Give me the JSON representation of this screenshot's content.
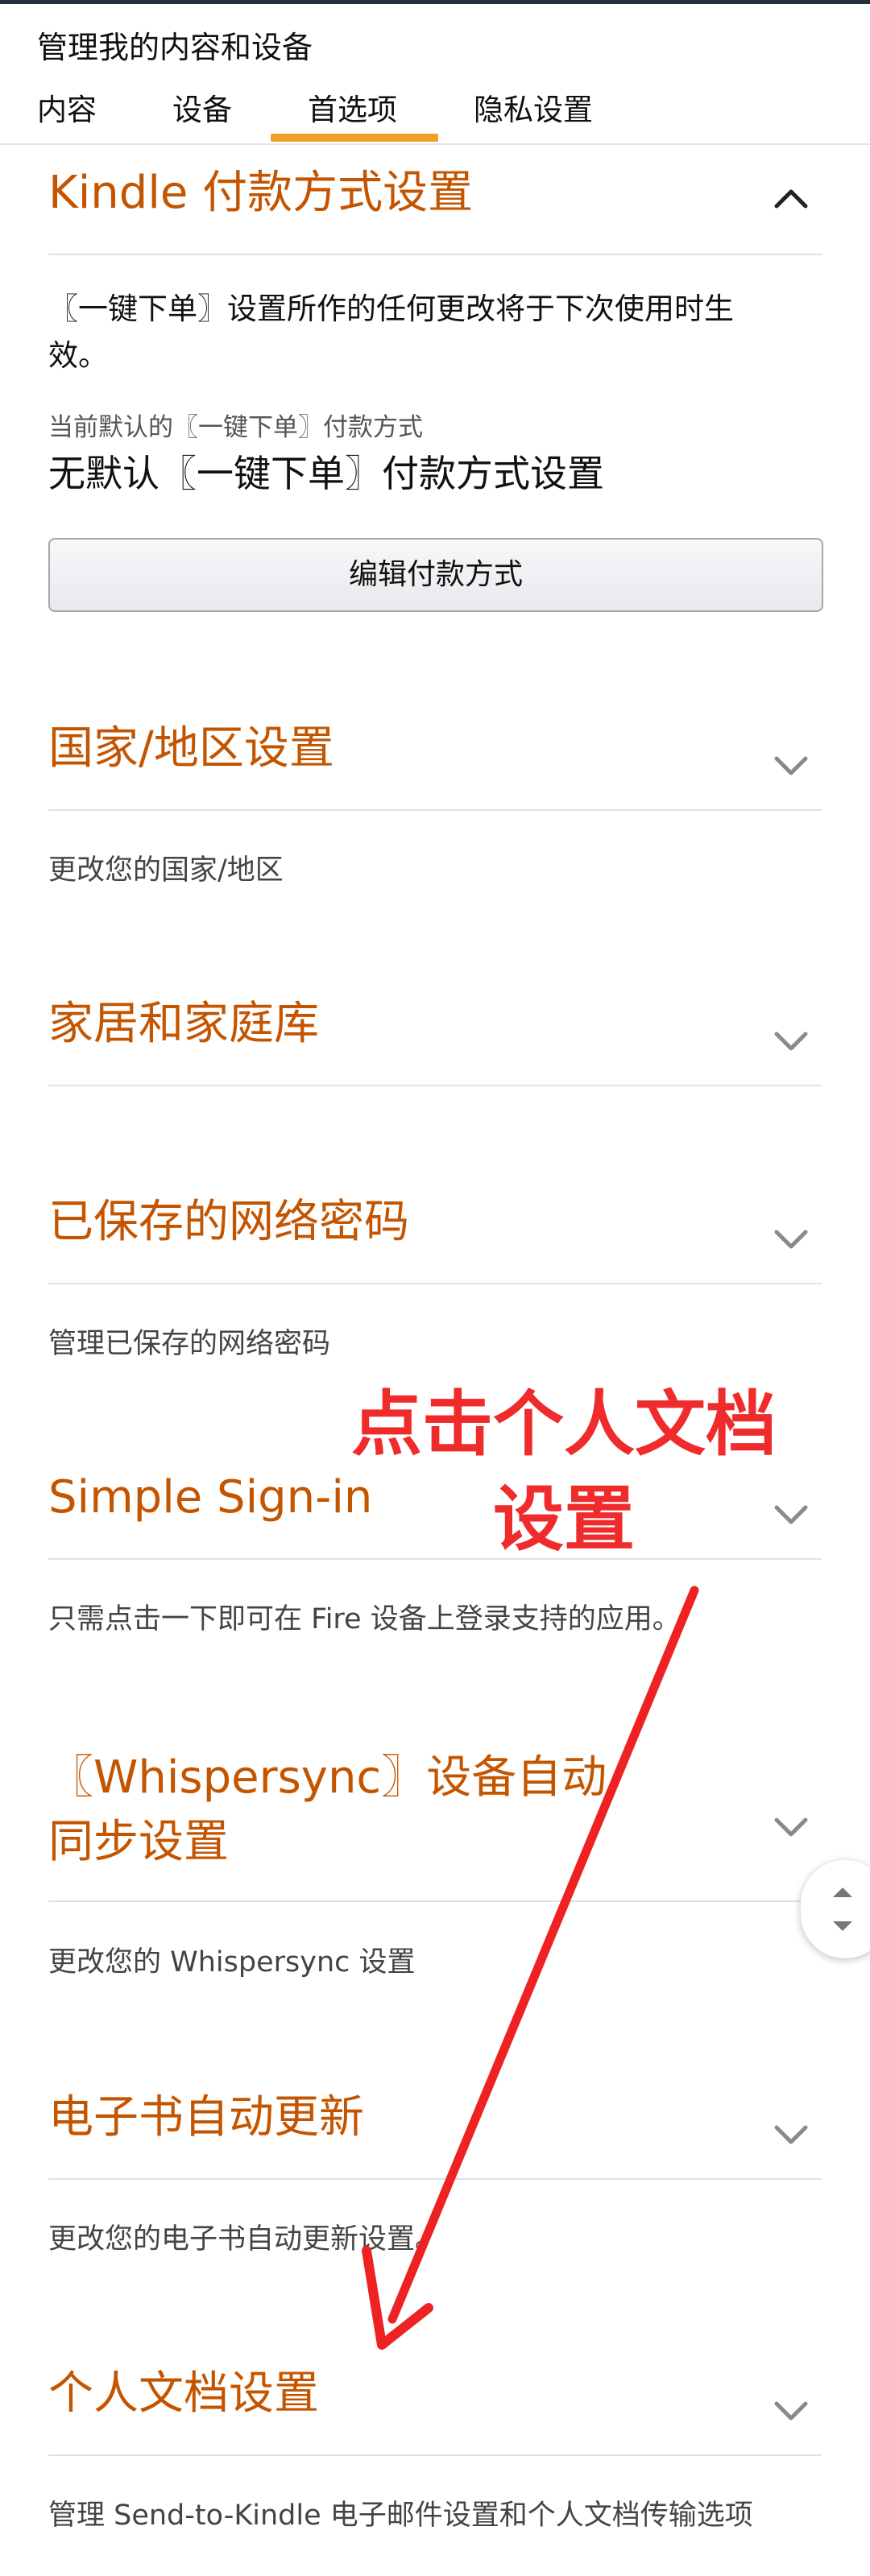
{
  "header": {
    "title": "管理我的内容和设备"
  },
  "tabs": [
    {
      "label": "内容"
    },
    {
      "label": "设备"
    },
    {
      "label": "首选项"
    },
    {
      "label": "隐私设置"
    }
  ],
  "sections": {
    "payment": {
      "title": "Kindle 付款方式设置",
      "note_line1": "〖一键下单〗设置所作的任何更改将于下次使用时生",
      "note_line2": "效。",
      "current_label": "当前默认的〖一键下单〗付款方式",
      "current_value": "无默认〖一键下单〗付款方式设置",
      "edit_button": "编辑付款方式"
    },
    "country": {
      "title": "国家/地区设置",
      "desc": "更改您的国家/地区"
    },
    "household": {
      "title": "家居和家庭库"
    },
    "wifi": {
      "title": "已保存的网络密码",
      "desc": "管理已保存的网络密码"
    },
    "signin": {
      "title": "Simple Sign-in",
      "desc": "只需点击一下即可在 Fire 设备上登录支持的应用。"
    },
    "whispersync": {
      "title_line1": "〖Whispersync〗设备自动",
      "title_line2": "同步设置",
      "desc": "更改您的 Whispersync 设置"
    },
    "ebook": {
      "title": "电子书自动更新",
      "desc": "更改您的电子书自动更新设置。"
    },
    "personal": {
      "title": "个人文档设置",
      "desc": "管理 Send-to-Kindle 电子邮件设置和个人文档传输选项"
    }
  },
  "annotation": {
    "line1": "点击个人文档",
    "line2": "设置"
  },
  "colors": {
    "accent": "#c45500",
    "tab_indicator": "#f0a024",
    "annotation": "#ef2b2b"
  },
  "icons": {
    "expanded": "chevron-up-icon",
    "collapsed": "chevron-down-icon",
    "scroll": "scroll-updown-icon"
  }
}
